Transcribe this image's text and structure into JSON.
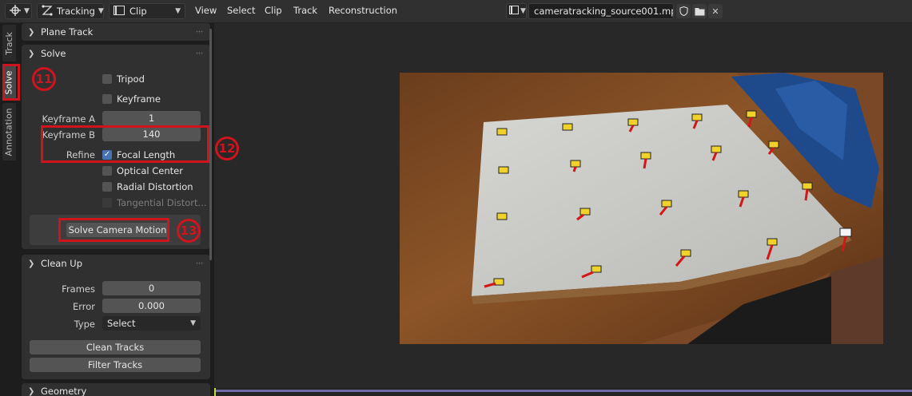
{
  "header": {
    "mode": "Tracking",
    "view_type": "Clip",
    "menus": [
      "View",
      "Select",
      "Clip",
      "Track",
      "Reconstruction"
    ],
    "clip_file": "cameratracking_source001.mp4"
  },
  "vtabs": [
    "Track",
    "Solve",
    "Annotation"
  ],
  "panels": {
    "plane_track": {
      "title": "Plane Track"
    },
    "solve": {
      "title": "Solve",
      "tripod": "Tripod",
      "keyframe": "Keyframe",
      "keyframe_a_label": "Keyframe A",
      "keyframe_a_value": "1",
      "keyframe_b_label": "Keyframe B",
      "keyframe_b_value": "140",
      "refine_label": "Refine",
      "focal_length": "Focal Length",
      "optical_center": "Optical Center",
      "radial_distortion": "Radial Distortion",
      "tangential_distortion": "Tangential Distort...",
      "solve_button": "Solve Camera Motion"
    },
    "clean_up": {
      "title": "Clean Up",
      "frames_label": "Frames",
      "frames_value": "0",
      "error_label": "Error",
      "error_value": "0.000",
      "type_label": "Type",
      "type_value": "Select",
      "clean_button": "Clean Tracks",
      "filter_button": "Filter Tracks"
    },
    "geometry": {
      "title": "Geometry"
    }
  },
  "annotations": {
    "a11": "11",
    "a12": "12",
    "a13": "13"
  },
  "colors": {
    "annotation_red": "#d0141e",
    "checkbox_blue": "#4772b3"
  }
}
